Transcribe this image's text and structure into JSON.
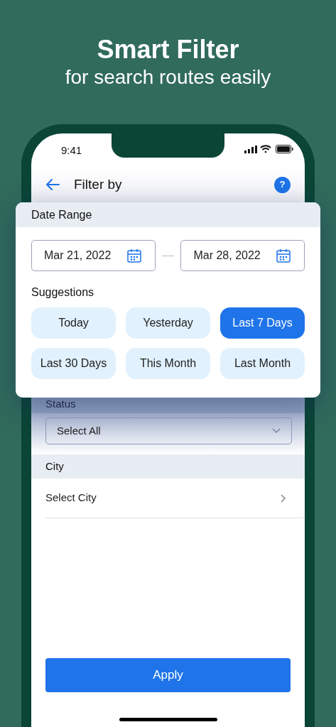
{
  "hero": {
    "title": "Smart Filter",
    "subtitle": "for search routes easily"
  },
  "status_bar": {
    "time": "9:41"
  },
  "header": {
    "title": "Filter by",
    "help": "?"
  },
  "date_range": {
    "label": "Date Range",
    "from": "Mar 21, 2022",
    "to": "Mar 28, 2022"
  },
  "suggestions": {
    "label": "Suggestions",
    "items": [
      {
        "label": "Today",
        "selected": false
      },
      {
        "label": "Yesterday",
        "selected": false
      },
      {
        "label": "Last 7 Days",
        "selected": true
      },
      {
        "label": "Last 30 Days",
        "selected": false
      },
      {
        "label": "This Month",
        "selected": false
      },
      {
        "label": "Last Month",
        "selected": false
      }
    ]
  },
  "status": {
    "label": "Status",
    "value": "Select All"
  },
  "city": {
    "label": "City",
    "value": "Select City"
  },
  "apply_button": "Apply"
}
